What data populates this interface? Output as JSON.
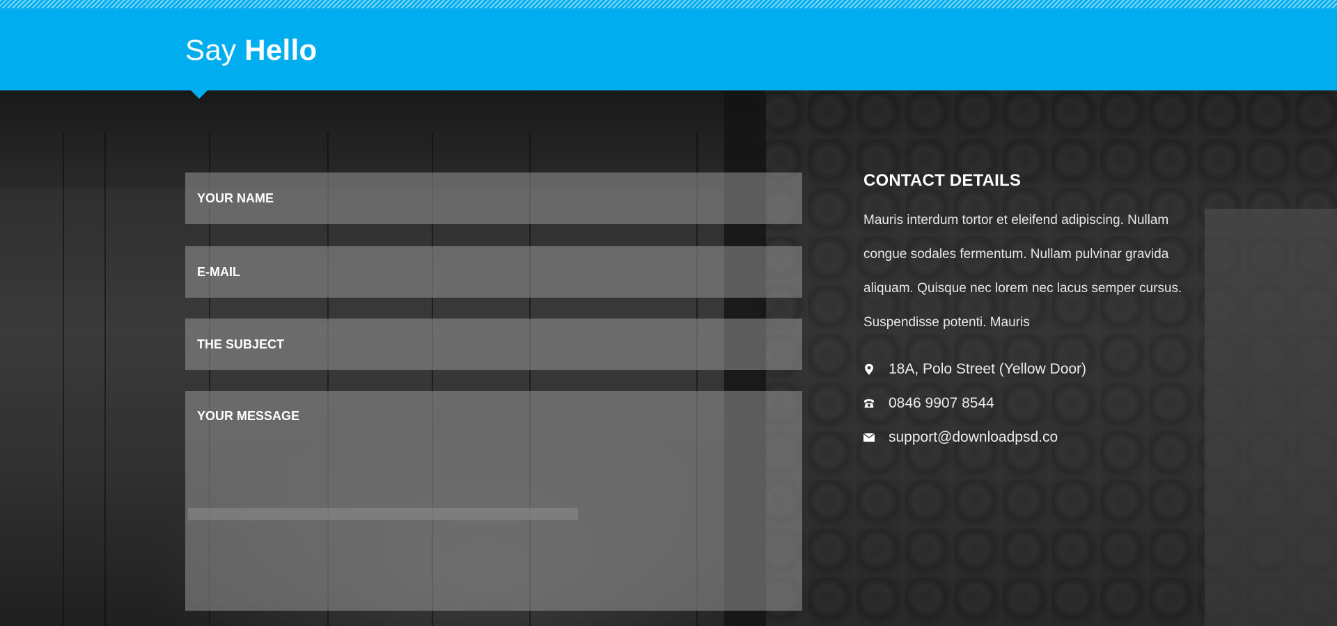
{
  "header": {
    "title_light": "Say",
    "title_bold": "Hello",
    "accent_color": "#00aeef"
  },
  "form": {
    "name_placeholder": "YOUR NAME",
    "email_placeholder": "E-MAIL",
    "subject_placeholder": "THE SUBJECT",
    "message_placeholder": "YOUR MESSAGE"
  },
  "contact": {
    "heading": "CONTACT DETAILS",
    "description": "Mauris interdum tortor et eleifend adipiscing. Nullam congue sodales fermentum. Nullam pulvinar gravida aliquam. Quisque nec lorem nec lacus semper cursus. Suspendisse potenti. Mauris",
    "items": [
      {
        "icon": "map-pin-icon",
        "text": "18A, Polo Street (Yellow Door)"
      },
      {
        "icon": "phone-icon",
        "text": "0846 9907 8544"
      },
      {
        "icon": "envelope-icon",
        "text": "support@downloadpsd.co"
      }
    ]
  }
}
